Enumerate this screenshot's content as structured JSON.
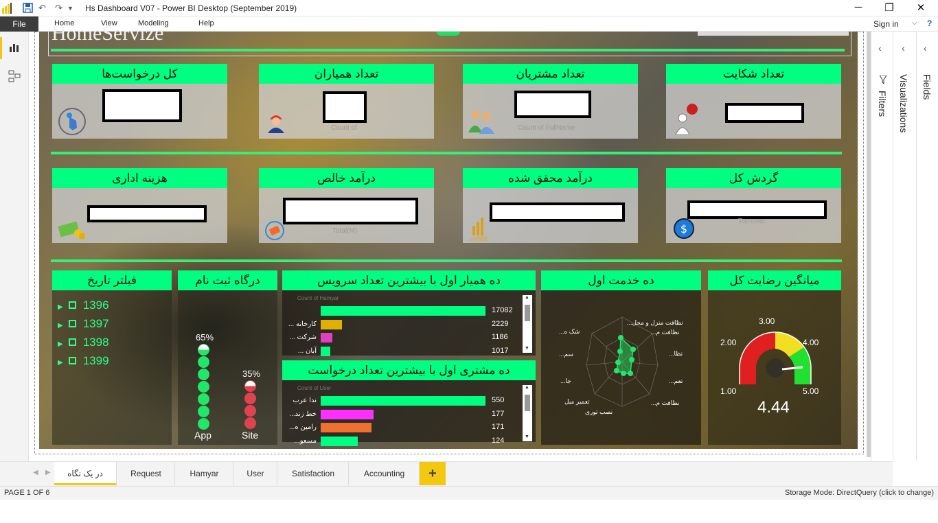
{
  "window": {
    "title": "Hs Dashboard V07 - Power BI Desktop (September 2019)"
  },
  "ribbon": {
    "file": "File",
    "tabs": [
      "Home",
      "View",
      "Modeling",
      "Help"
    ],
    "signin": "Sign in"
  },
  "report": {
    "brand": "HomeServize"
  },
  "kpi_row1": [
    {
      "title": "کل درخواست‌ها",
      "faint": ""
    },
    {
      "title": "تعداد همیاران",
      "faint": "Count of"
    },
    {
      "title": "تعداد مشتریان",
      "faint": "Count of FullName"
    },
    {
      "title": "تعداد شکایت",
      "faint": ""
    }
  ],
  "kpi_row2": [
    {
      "title": "هزینه اداری",
      "faint": ""
    },
    {
      "title": "درآمد خالص",
      "faint": "Total(M)"
    },
    {
      "title": "درآمد محقق شده",
      "faint": ""
    },
    {
      "title": "گردش کل",
      "faint": "Turnover"
    }
  ],
  "filter": {
    "title": "فیلتر تاریخ",
    "years": [
      "1396",
      "1397",
      "1398",
      "1399"
    ]
  },
  "channel": {
    "title": "درگاه ثبت نام",
    "app_pct": "65%",
    "site_pct": "35%",
    "app_label": "App",
    "site_label": "Site",
    "app_color": "#22e66a",
    "site_color": "#e0434f"
  },
  "top_hamyar": {
    "title": "ده همیار اول با بیشترین تعداد سرویس",
    "axis_label": "Count of Hamyar",
    "rows": [
      {
        "cat": "",
        "value": "17082",
        "color": "#00ff80"
      },
      {
        "cat": "... کارخانه",
        "value": "2229",
        "color": "#e0b000"
      },
      {
        "cat": "... شرکت",
        "value": "1186",
        "color": "#e040c0"
      },
      {
        "cat": "... آبان",
        "value": "1017",
        "color": "#00ff80"
      }
    ]
  },
  "top_customer": {
    "title": "ده مشتری اول با بیشترین تعداد درخواست",
    "axis_label": "Count of User",
    "rows": [
      {
        "cat": "ندا عرب",
        "value": "550",
        "color": "#00ff80"
      },
      {
        "cat": "...خط زند",
        "value": "177",
        "color": "#ff30ff"
      },
      {
        "cat": "...رامین ه",
        "value": "171",
        "color": "#f07030"
      },
      {
        "cat": "...مسعو",
        "value": "124",
        "color": "#00ff80"
      }
    ]
  },
  "top_service": {
    "title": "ده خدمت اول",
    "labels": [
      "...نظافت منزل و محل",
      "...نظافت م",
      "...نظا",
      "...تعم",
      "...نظافت م",
      "نصب توری",
      "تعمیر مبل",
      "...جا",
      "...سم",
      "...شک ه"
    ]
  },
  "satisfaction": {
    "title": "میانگین رضایت کل",
    "value": "4.44",
    "ticks": [
      "1.00",
      "2.00",
      "3.00",
      "4.00",
      "5.00"
    ]
  },
  "panes": {
    "visualizations": "Visualizations",
    "fields": "Fields",
    "filters": "Filters"
  },
  "pages": {
    "tabs": [
      "در یک نگاه",
      "Request",
      "Hamyar",
      "User",
      "Satisfaction",
      "Accounting"
    ],
    "add": "+"
  },
  "status": {
    "page": "PAGE 1 OF 6",
    "storage": "Storage Mode: DirectQuery (click to change)"
  }
}
